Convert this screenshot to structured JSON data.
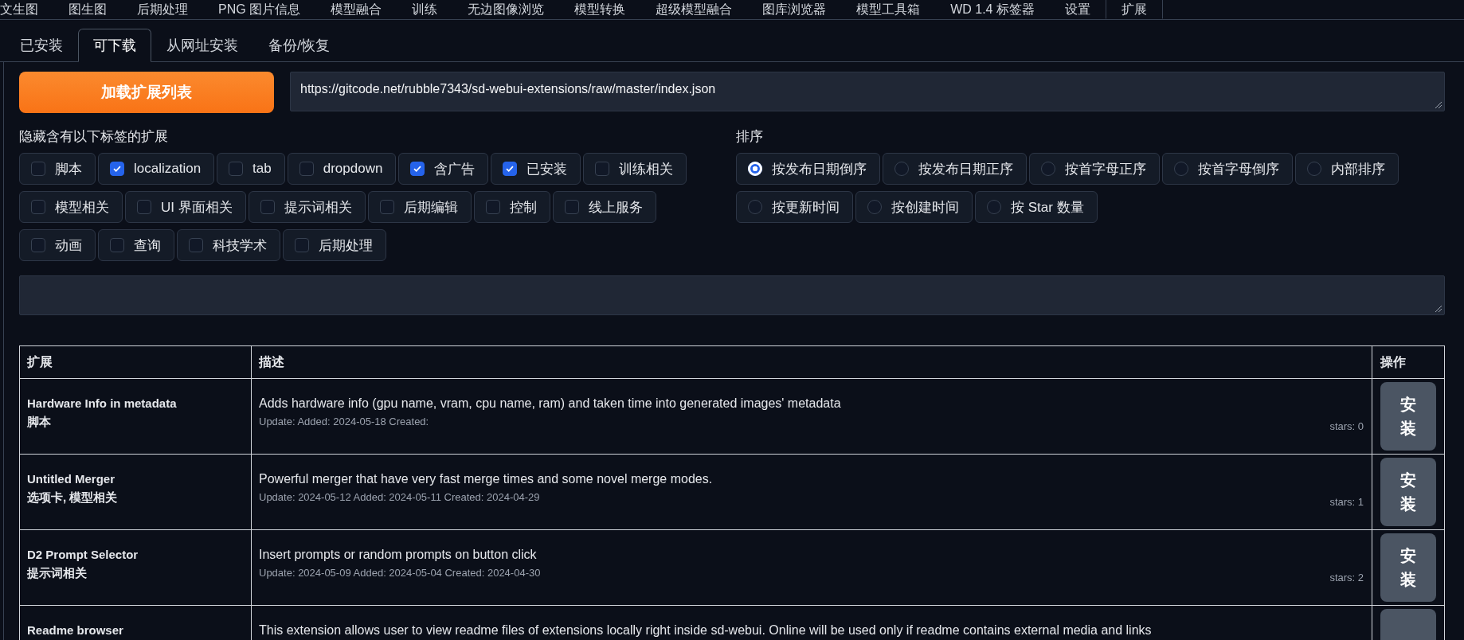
{
  "top_tabs": [
    {
      "label": "文生图",
      "selected": false
    },
    {
      "label": "图生图",
      "selected": false
    },
    {
      "label": "后期处理",
      "selected": false
    },
    {
      "label": "PNG 图片信息",
      "selected": false
    },
    {
      "label": "模型融合",
      "selected": false
    },
    {
      "label": "训练",
      "selected": false
    },
    {
      "label": "无边图像浏览",
      "selected": false
    },
    {
      "label": "模型转换",
      "selected": false
    },
    {
      "label": "超级模型融合",
      "selected": false
    },
    {
      "label": "图库浏览器",
      "selected": false
    },
    {
      "label": "模型工具箱",
      "selected": false
    },
    {
      "label": "WD 1.4 标签器",
      "selected": false
    },
    {
      "label": "设置",
      "selected": false
    },
    {
      "label": "扩展",
      "selected": true
    }
  ],
  "sub_tabs": [
    {
      "label": "已安装",
      "selected": false
    },
    {
      "label": "可下载",
      "selected": true
    },
    {
      "label": "从网址安装",
      "selected": false
    },
    {
      "label": "备份/恢复",
      "selected": false
    }
  ],
  "load_button": "加载扩展列表",
  "index_url": "https://gitcode.net/rubble7343/sd-webui-extensions/raw/master/index.json",
  "hide_tags": {
    "label": "隐藏含有以下标签的扩展",
    "options": [
      {
        "label": "脚本",
        "checked": false
      },
      {
        "label": "localization",
        "checked": true
      },
      {
        "label": "tab",
        "checked": false
      },
      {
        "label": "dropdown",
        "checked": false
      },
      {
        "label": "含广告",
        "checked": true
      },
      {
        "label": "已安装",
        "checked": true
      },
      {
        "label": "训练相关",
        "checked": false
      },
      {
        "label": "模型相关",
        "checked": false
      },
      {
        "label": "UI 界面相关",
        "checked": false
      },
      {
        "label": "提示词相关",
        "checked": false
      },
      {
        "label": "后期编辑",
        "checked": false
      },
      {
        "label": "控制",
        "checked": false
      },
      {
        "label": "线上服务",
        "checked": false
      },
      {
        "label": "动画",
        "checked": false
      },
      {
        "label": "查询",
        "checked": false
      },
      {
        "label": "科技学术",
        "checked": false
      },
      {
        "label": "后期处理",
        "checked": false
      }
    ]
  },
  "sort": {
    "label": "排序",
    "options": [
      {
        "label": "按发布日期倒序",
        "selected": true
      },
      {
        "label": "按发布日期正序",
        "selected": false
      },
      {
        "label": "按首字母正序",
        "selected": false
      },
      {
        "label": "按首字母倒序",
        "selected": false
      },
      {
        "label": "内部排序",
        "selected": false
      },
      {
        "label": "按更新时间",
        "selected": false
      },
      {
        "label": "按创建时间",
        "selected": false
      },
      {
        "label": "按 Star 数量",
        "selected": false
      }
    ]
  },
  "table": {
    "columns": [
      "扩展",
      "描述",
      "操作"
    ],
    "rows": [
      {
        "name": "Hardware Info in metadata",
        "tags": "脚本",
        "description": "Adds hardware info (gpu name, vram, cpu name, ram) and taken time into generated images' metadata",
        "dates": "Update: Added: 2024-05-18 Created:",
        "stars": "stars: 0",
        "action": "安装"
      },
      {
        "name": "Untitled Merger",
        "tags": "选项卡, 模型相关",
        "description": "Powerful merger that have very fast merge times and some novel merge modes.",
        "dates": "Update: 2024-05-12 Added: 2024-05-11 Created: 2024-04-29",
        "stars": "stars: 1",
        "action": "安装"
      },
      {
        "name": "D2 Prompt Selector",
        "tags": "提示词相关",
        "description": "Insert prompts or random prompts on button click",
        "dates": "Update: 2024-05-09 Added: 2024-05-04 Created: 2024-04-30",
        "stars": "stars: 2",
        "action": "安装"
      },
      {
        "name": "Readme browser",
        "description": "This extension allows user to view readme files of extensions locally right inside sd-webui. Online will be used only if readme contains external media and links"
      }
    ]
  }
}
